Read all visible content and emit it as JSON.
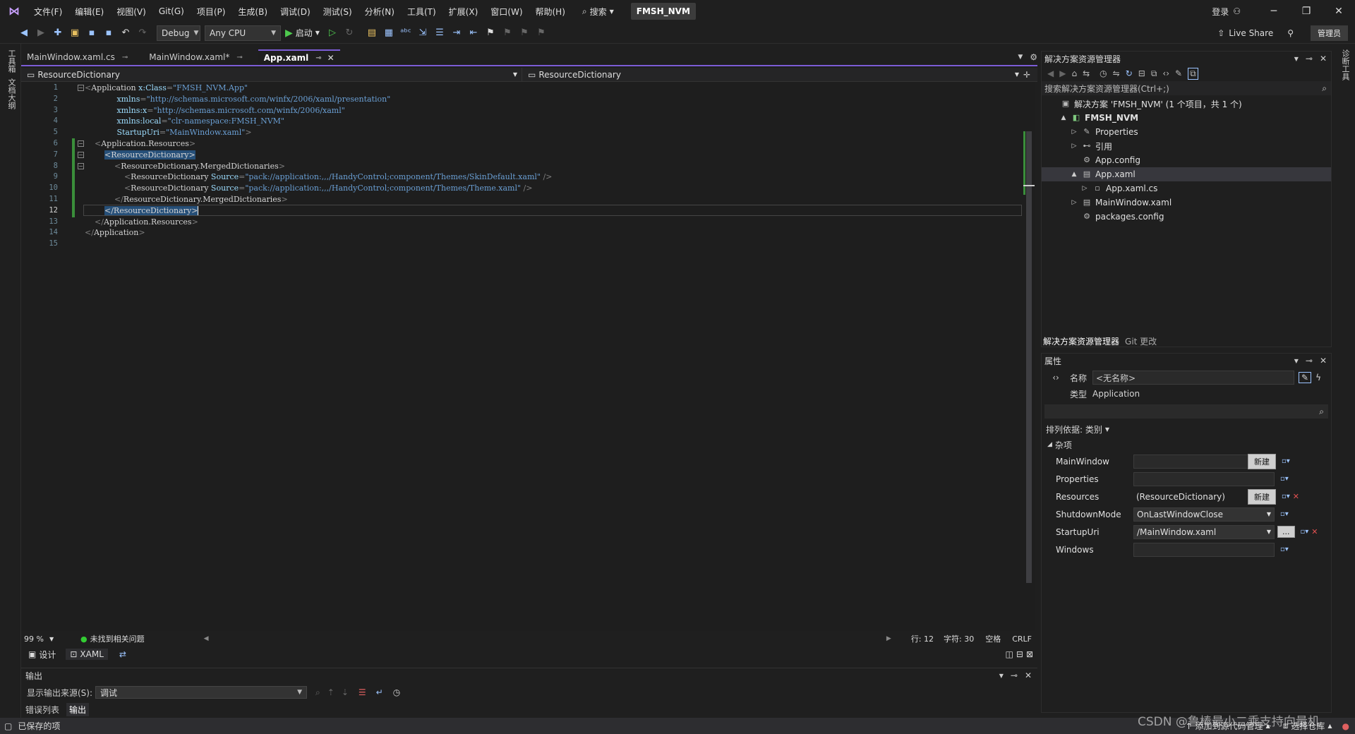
{
  "titlebar": {
    "menus": [
      "文件(F)",
      "编辑(E)",
      "视图(V)",
      "Git(G)",
      "项目(P)",
      "生成(B)",
      "调试(D)",
      "测试(S)",
      "分析(N)",
      "工具(T)",
      "扩展(X)",
      "窗口(W)",
      "帮助(H)"
    ],
    "search": "搜索",
    "project": "FMSH_NVM",
    "login": "登录"
  },
  "toolbar": {
    "config": "Debug",
    "platform": "Any CPU",
    "start": "启动",
    "live_share": "Live Share",
    "admin": "管理员"
  },
  "left_strip": {
    "toolbox": "工具箱",
    "doc_outline": "文档大纲"
  },
  "right_strip": {
    "diag": "诊断工具"
  },
  "tabs": [
    {
      "label": "MainWindow.xaml.cs"
    },
    {
      "label": "MainWindow.xaml*"
    },
    {
      "label": "App.xaml"
    }
  ],
  "navbar": {
    "left": "ResourceDictionary",
    "right": "ResourceDictionary"
  },
  "editor": {
    "line_numbers": [
      "1",
      "2",
      "3",
      "4",
      "5",
      "6",
      "7",
      "8",
      "9",
      "10",
      "11",
      "12",
      "13",
      "14",
      "15"
    ],
    "lines": [
      {
        "parts": [
          [
            "br",
            "<"
          ],
          [
            "tag",
            "Application "
          ],
          [
            "attr",
            "x:Class"
          ],
          [
            "br",
            "="
          ],
          [
            "str",
            "\"FMSH_NVM.App\""
          ]
        ]
      },
      {
        "parts": [
          [
            "txt",
            "             "
          ],
          [
            "attr",
            "xmlns"
          ],
          [
            "br",
            "="
          ],
          [
            "str",
            "\"http://schemas.microsoft.com/winfx/2006/xaml/presentation\""
          ]
        ]
      },
      {
        "parts": [
          [
            "txt",
            "             "
          ],
          [
            "attr",
            "xmlns:x"
          ],
          [
            "br",
            "="
          ],
          [
            "str",
            "\"http://schemas.microsoft.com/winfx/2006/xaml\""
          ]
        ]
      },
      {
        "parts": [
          [
            "txt",
            "             "
          ],
          [
            "attr",
            "xmlns:local"
          ],
          [
            "br",
            "="
          ],
          [
            "str",
            "\"clr-namespace:FMSH_NVM\""
          ]
        ]
      },
      {
        "parts": [
          [
            "txt",
            "             "
          ],
          [
            "attr",
            "StartupUri"
          ],
          [
            "br",
            "="
          ],
          [
            "str",
            "\"MainWindow.xaml\""
          ],
          [
            "br",
            ">"
          ]
        ]
      },
      {
        "parts": [
          [
            "txt",
            "    "
          ],
          [
            "br",
            "<"
          ],
          [
            "tag",
            "Application.Resources"
          ],
          [
            "br",
            ">"
          ]
        ]
      },
      {
        "parts": [
          [
            "txt",
            "        "
          ],
          [
            "hl",
            "<ResourceDictionary>"
          ]
        ]
      },
      {
        "parts": [
          [
            "txt",
            "            "
          ],
          [
            "br",
            "<"
          ],
          [
            "tag",
            "ResourceDictionary.MergedDictionaries"
          ],
          [
            "br",
            ">"
          ]
        ]
      },
      {
        "parts": [
          [
            "txt",
            "                "
          ],
          [
            "br",
            "<"
          ],
          [
            "tag",
            "ResourceDictionary "
          ],
          [
            "attr",
            "Source"
          ],
          [
            "br",
            "="
          ],
          [
            "str",
            "\"pack://application:,,,/HandyControl;component/Themes/SkinDefault.xaml\""
          ],
          [
            "br",
            " />"
          ]
        ]
      },
      {
        "parts": [
          [
            "txt",
            "                "
          ],
          [
            "br",
            "<"
          ],
          [
            "tag",
            "ResourceDictionary "
          ],
          [
            "attr",
            "Source"
          ],
          [
            "br",
            "="
          ],
          [
            "str",
            "\"pack://application:,,,/HandyControl;component/Themes/Theme.xaml\""
          ],
          [
            "br",
            " />"
          ]
        ]
      },
      {
        "parts": [
          [
            "txt",
            "            "
          ],
          [
            "br",
            "</"
          ],
          [
            "tag",
            "ResourceDictionary.MergedDictionaries"
          ],
          [
            "br",
            ">"
          ]
        ]
      },
      {
        "parts": [
          [
            "txt",
            "        "
          ],
          [
            "hl",
            "</ResourceDictionary>"
          ]
        ]
      },
      {
        "parts": [
          [
            "txt",
            "    "
          ],
          [
            "br",
            "</"
          ],
          [
            "tag",
            "Application.Resources"
          ],
          [
            "br",
            ">"
          ]
        ]
      },
      {
        "parts": [
          [
            "br",
            "</"
          ],
          [
            "tag",
            "Application"
          ],
          [
            "br",
            ">"
          ]
        ]
      },
      {
        "parts": []
      }
    ]
  },
  "edstatus": {
    "zoom": "99 %",
    "issues": "未找到相关问题",
    "row": "行: 12",
    "col": "字符: 30",
    "spaces": "空格",
    "eol": "CRLF"
  },
  "viewbar": {
    "design": "设计",
    "xaml": "XAML"
  },
  "output": {
    "title": "输出",
    "source_label": "显示输出来源(S):",
    "source_value": "调试",
    "tab_errors": "错误列表",
    "tab_output": "输出"
  },
  "solution_explorer": {
    "title": "解决方案资源管理器",
    "search_placeholder": "搜索解决方案资源管理器(Ctrl+;)",
    "items": [
      {
        "label": "解决方案 'FMSH_NVM' (1 个项目，共 1 个)",
        "indent": 0,
        "arrow": "",
        "icon": "solution-icon"
      },
      {
        "label": "FMSH_NVM",
        "indent": 1,
        "arrow": "▲",
        "icon": "csproj-icon",
        "bold": true
      },
      {
        "label": "Properties",
        "indent": 2,
        "arrow": "▷",
        "icon": "wrench-icon"
      },
      {
        "label": "引用",
        "indent": 2,
        "arrow": "▷",
        "icon": "reference-icon"
      },
      {
        "label": "App.config",
        "indent": 2,
        "arrow": "",
        "icon": "config-icon"
      },
      {
        "label": "App.xaml",
        "indent": 2,
        "arrow": "▲",
        "icon": "xaml-icon",
        "selected": true
      },
      {
        "label": "App.xaml.cs",
        "indent": 3,
        "arrow": "▷",
        "icon": "cs-file-icon"
      },
      {
        "label": "MainWindow.xaml",
        "indent": 2,
        "arrow": "▷",
        "icon": "xaml-icon"
      },
      {
        "label": "packages.config",
        "indent": 2,
        "arrow": "",
        "icon": "config-icon"
      }
    ],
    "bottom_tabs": [
      "解决方案资源管理器",
      "Git 更改"
    ]
  },
  "properties": {
    "title": "属性",
    "name_label": "名称",
    "name_value": "<无名称>",
    "type_label": "类型",
    "type_value": "Application",
    "sort_label": "排列依据: 类别",
    "category": "杂项",
    "rows": [
      {
        "name": "MainWindow",
        "value": "",
        "btn": "新建"
      },
      {
        "name": "Properties",
        "value": "",
        "btn": ""
      },
      {
        "name": "Resources",
        "value": "(ResourceDictionary)",
        "btn": "新建"
      },
      {
        "name": "ShutdownMode",
        "value": "OnLastWindowClose",
        "btn": ""
      },
      {
        "name": "StartupUri",
        "value": "/MainWindow.xaml",
        "btn": "..."
      },
      {
        "name": "Windows",
        "value": "",
        "btn": ""
      }
    ]
  },
  "statusbar": {
    "saved": "已保存的项",
    "add_source": "添加到源代码管理",
    "select_repo": "选择仓库",
    "watermark": "CSDN @鲁棒最小二乘支持向量机"
  }
}
